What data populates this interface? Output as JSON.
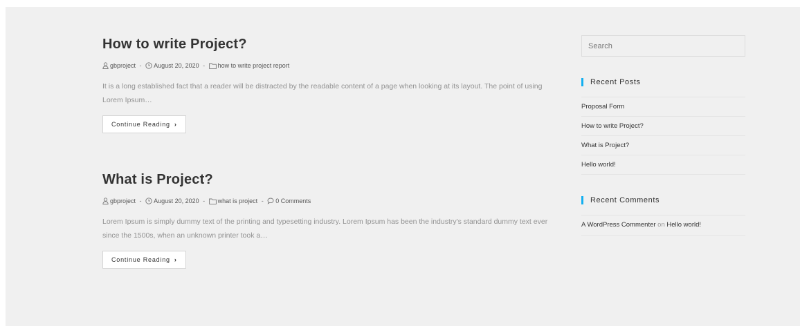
{
  "posts": [
    {
      "title": "How to write Project?",
      "author": "gbproject",
      "date": "August 20, 2020",
      "category": "how to write project report",
      "comments": "",
      "excerpt": "It is a long established fact that a reader will be distracted by the readable content of a page when looking at its layout. The point of using Lorem Ipsum…",
      "button_label": "Continue Reading"
    },
    {
      "title": "What is Project?",
      "author": "gbproject",
      "date": "August 20, 2020",
      "category": "what is project",
      "comments": "0 Comments",
      "excerpt": "Lorem Ipsum is simply dummy text of the printing and typesetting industry. Lorem Ipsum has been the industry's standard dummy text ever since the 1500s, when an unknown printer took a…",
      "button_label": "Continue Reading"
    }
  ],
  "meta_separator": "-",
  "sidebar": {
    "search_placeholder": "Search",
    "recent_posts": {
      "title": "Recent Posts",
      "items": [
        "Proposal Form",
        "How to write Project?",
        "What is Project?",
        "Hello world!"
      ]
    },
    "recent_comments": {
      "title": "Recent Comments",
      "author": "A WordPress Commenter",
      "on_word": "on",
      "post": "Hello world!"
    }
  },
  "colors": {
    "accent": "#13aff0",
    "background": "#f0f0f0",
    "title": "#333333",
    "excerpt": "#929292"
  },
  "icons": {
    "author": "user-icon",
    "date": "clock-icon",
    "category": "folder-icon",
    "comments": "comment-icon",
    "button": "chevron-right-icon"
  }
}
